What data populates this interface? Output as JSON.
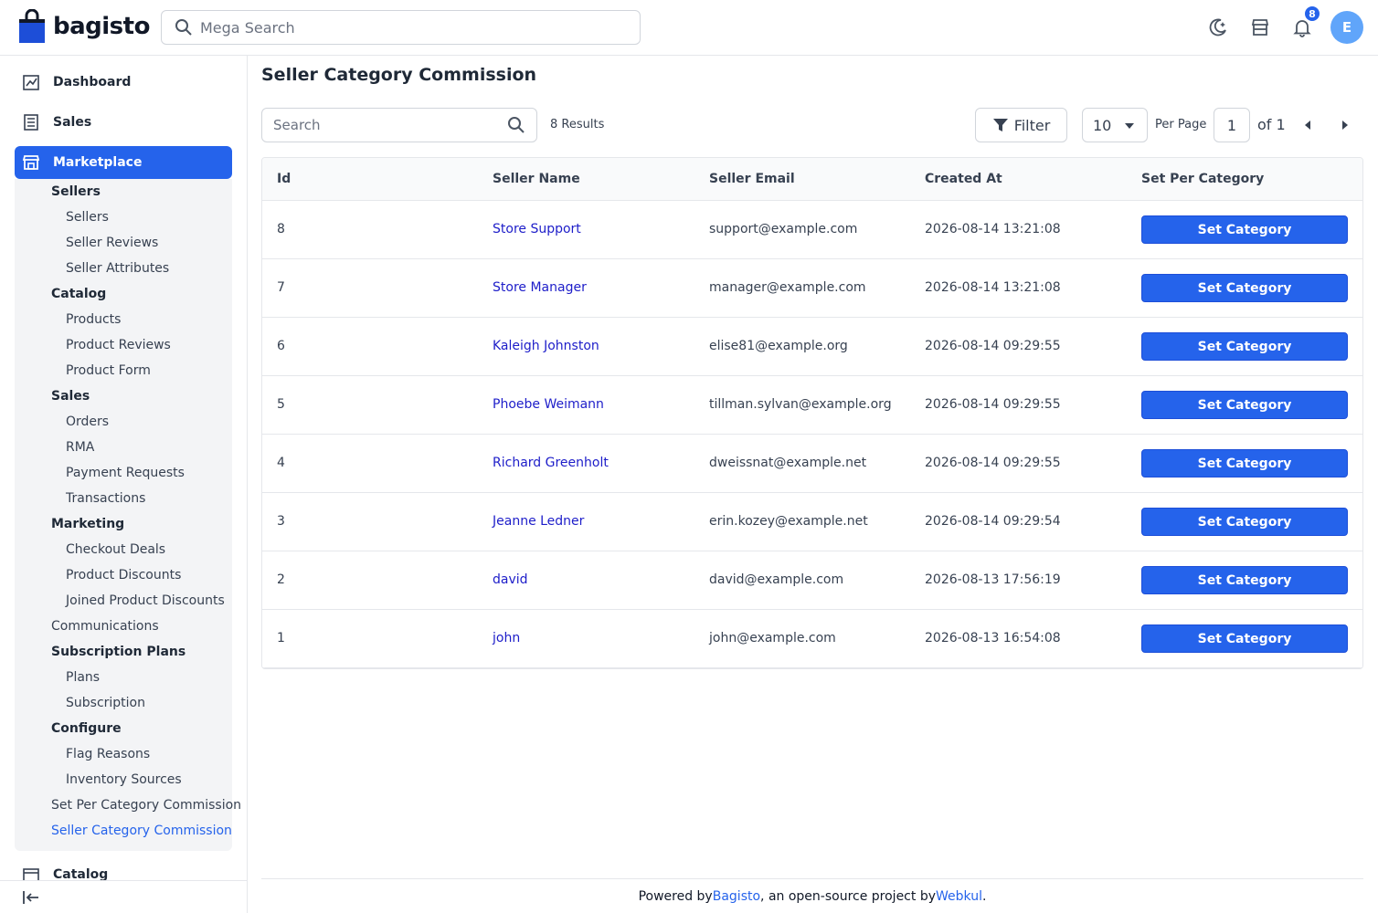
{
  "brand": {
    "name": "bagisto",
    "accent": "#2563eb"
  },
  "mega_search": {
    "placeholder": "Mega Search"
  },
  "header": {
    "notification_count": "8",
    "avatar_initial": "E"
  },
  "sidebar": {
    "top_items": [
      {
        "label": "Dashboard",
        "icon": "dashboard-icon"
      },
      {
        "label": "Sales",
        "icon": "sales-icon"
      },
      {
        "label": "Marketplace",
        "icon": "store-icon"
      }
    ],
    "marketplace_menu": [
      {
        "label": "Sellers",
        "level": 1
      },
      {
        "label": "Sellers",
        "level": 2
      },
      {
        "label": "Seller Reviews",
        "level": 2
      },
      {
        "label": "Seller Attributes",
        "level": 2
      },
      {
        "label": "Catalog",
        "level": 1
      },
      {
        "label": "Products",
        "level": 2
      },
      {
        "label": "Product Reviews",
        "level": 2
      },
      {
        "label": "Product Form",
        "level": 2
      },
      {
        "label": "Sales",
        "level": 1
      },
      {
        "label": "Orders",
        "level": 2
      },
      {
        "label": "RMA",
        "level": 2
      },
      {
        "label": "Payment Requests",
        "level": 2
      },
      {
        "label": "Transactions",
        "level": 2
      },
      {
        "label": "Marketing",
        "level": 1
      },
      {
        "label": "Checkout Deals",
        "level": 2
      },
      {
        "label": "Product Discounts",
        "level": 2
      },
      {
        "label": "Joined Product Discounts",
        "level": 2
      },
      {
        "label": "Communications",
        "level": 1
      },
      {
        "label": "Subscription Plans",
        "level": 1
      },
      {
        "label": "Plans",
        "level": 2
      },
      {
        "label": "Subscription",
        "level": 2
      },
      {
        "label": "Configure",
        "level": 1
      },
      {
        "label": "Flag Reasons",
        "level": 2
      },
      {
        "label": "Inventory Sources",
        "level": 2
      },
      {
        "label": "Set Per Category Commission",
        "level": 1
      },
      {
        "label": "Seller Category Commission",
        "level": 1
      }
    ],
    "after_items": [
      {
        "label": "Catalog",
        "icon": "catalog-icon"
      }
    ]
  },
  "page": {
    "title": "Seller Category Commission",
    "search_placeholder": "Search",
    "results": "8 Results",
    "filter_label": "Filter",
    "per_page_value": "10",
    "per_page_label": "Per Page",
    "current_page": "1",
    "of_label": "of 1"
  },
  "table": {
    "headers": [
      "Id",
      "Seller Name",
      "Seller Email",
      "Created At",
      "Set Per Category"
    ],
    "action_label": "Set Category",
    "rows": [
      {
        "id": "8",
        "name": "Store Support",
        "email": "support@example.com",
        "created": "2026-08-14 13:21:08"
      },
      {
        "id": "7",
        "name": "Store Manager",
        "email": "manager@example.com",
        "created": "2026-08-14 13:21:08"
      },
      {
        "id": "6",
        "name": "Kaleigh Johnston",
        "email": "elise81@example.org",
        "created": "2026-08-14 09:29:55"
      },
      {
        "id": "5",
        "name": "Phoebe Weimann",
        "email": "tillman.sylvan@example.org",
        "created": "2026-08-14 09:29:55"
      },
      {
        "id": "4",
        "name": "Richard Greenholt",
        "email": "dweissnat@example.net",
        "created": "2026-08-14 09:29:55"
      },
      {
        "id": "3",
        "name": "Jeanne Ledner",
        "email": "erin.kozey@example.net",
        "created": "2026-08-14 09:29:54"
      },
      {
        "id": "2",
        "name": "david",
        "email": "david@example.com",
        "created": "2026-08-13 17:56:19"
      },
      {
        "id": "1",
        "name": "john",
        "email": "john@example.com",
        "created": "2026-08-13 16:54:08"
      }
    ]
  },
  "footer": {
    "prefix": "Powered by ",
    "link1": "Bagisto",
    "middle": ", an open-source project by ",
    "link2": "Webkul",
    "suffix": "."
  }
}
